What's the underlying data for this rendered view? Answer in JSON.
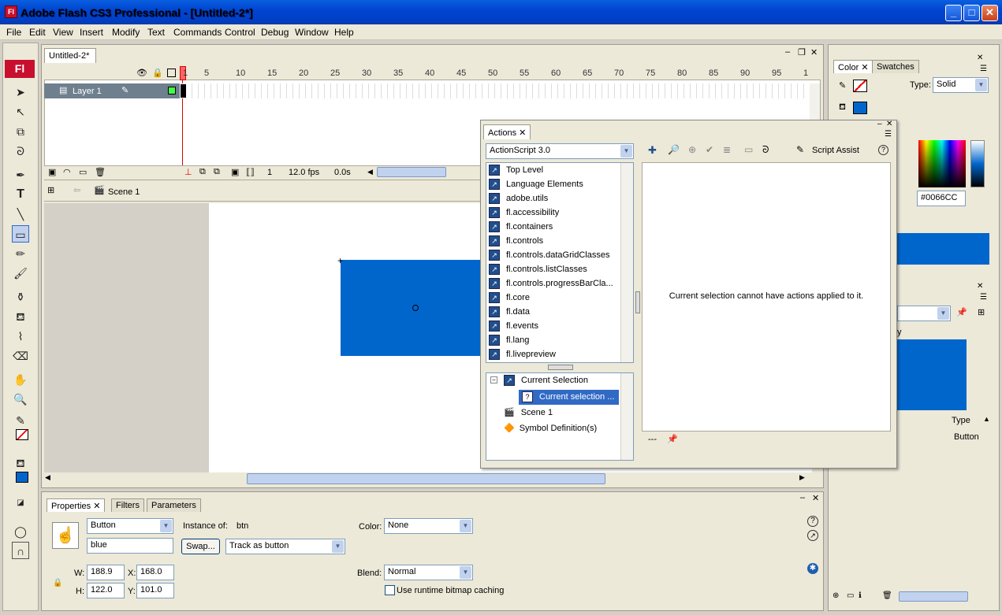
{
  "window": {
    "title": "Adobe Flash CS3 Professional - [Untitled-2*]",
    "app_icon": "Fl"
  },
  "menu": [
    "File",
    "Edit",
    "View",
    "Insert",
    "Modify",
    "Text",
    "Commands",
    "Control",
    "Debug",
    "Window",
    "Help"
  ],
  "toolbar": {
    "logo": "Fl"
  },
  "document": {
    "tab": "Untitled-2*",
    "frame_numbers": [
      "1",
      "5",
      "10",
      "15",
      "20",
      "25",
      "30",
      "35",
      "40",
      "45",
      "50",
      "55",
      "60",
      "65",
      "70",
      "75",
      "80",
      "85",
      "90",
      "95",
      "1"
    ],
    "layer_name": "Layer 1",
    "current_frame": "1",
    "fps": "12.0 fps",
    "elapsed": "0.0s",
    "scene": "Scene 1"
  },
  "properties": {
    "tabs": [
      "Properties",
      "Filters",
      "Parameters"
    ],
    "symbol_type": "Button",
    "instance_name": "blue",
    "instance_of_label": "Instance of:",
    "instance_of_value": "btn",
    "swap_label": "Swap...",
    "track_option": "Track as button",
    "color_label": "Color:",
    "color_value": "None",
    "blend_label": "Blend:",
    "blend_value": "Normal",
    "runtime_caching": "Use runtime bitmap caching",
    "w_label": "W:",
    "w_value": "188.9",
    "h_label": "H:",
    "h_value": "122.0",
    "x_label": "X:",
    "x_value": "168.0",
    "y_label": "Y:",
    "y_value": "101.0"
  },
  "color_panel": {
    "tabs": [
      "Color",
      "Swatches"
    ],
    "type_label": "Type:",
    "type_value": "Solid",
    "hex": "#0066CC",
    "fill_color": "#0066cc"
  },
  "library_panel": {
    "partial_label": "y",
    "type_header": "Type",
    "item_type": "Button"
  },
  "actions": {
    "tab": "Actions",
    "language": "ActionScript 3.0",
    "script_assist": "Script Assist",
    "items": [
      "Top Level",
      "Language Elements",
      "adobe.utils",
      "fl.accessibility",
      "fl.containers",
      "fl.controls",
      "fl.controls.dataGridClasses",
      "fl.controls.listClasses",
      "fl.controls.progressBarCla...",
      "fl.core",
      "fl.data",
      "fl.events",
      "fl.lang",
      "fl.livepreview"
    ],
    "tree": {
      "current_selection": "Current Selection",
      "current_selection_child": "Current selection ...",
      "scene": "Scene 1",
      "symbol_definitions": "Symbol Definition(s)"
    },
    "message": "Current selection cannot have actions applied to it.",
    "line_marker": "---"
  }
}
